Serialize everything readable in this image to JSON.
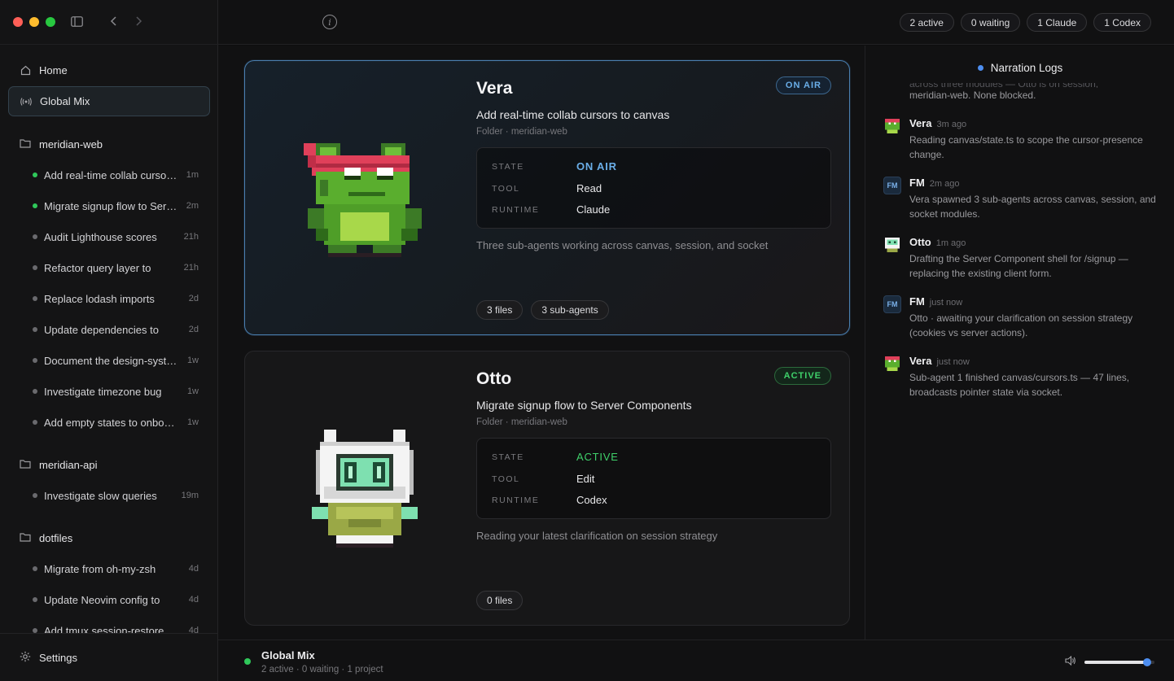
{
  "titlebar": {
    "info_icon": "info-icon"
  },
  "status_pills": [
    "2 active",
    "0 waiting",
    "1 Claude",
    "1 Codex"
  ],
  "nav": {
    "home": "Home",
    "global_mix": "Global Mix"
  },
  "projects": [
    {
      "name": "meridian-web",
      "tasks": [
        {
          "label": "Add real-time collab cursors to canvas",
          "time": "1m",
          "active": true
        },
        {
          "label": "Migrate signup flow to Server Components",
          "time": "2m",
          "active": true
        },
        {
          "label": "Audit Lighthouse scores",
          "time": "21h",
          "active": false
        },
        {
          "label": "Refactor query layer to",
          "time": "21h",
          "active": false
        },
        {
          "label": "Replace lodash imports",
          "time": "2d",
          "active": false
        },
        {
          "label": "Update dependencies to",
          "time": "2d",
          "active": false
        },
        {
          "label": "Document the design-system",
          "time": "1w",
          "active": false
        },
        {
          "label": "Investigate timezone bug",
          "time": "1w",
          "active": false
        },
        {
          "label": "Add empty states to onboarding",
          "time": "1w",
          "active": false
        }
      ]
    },
    {
      "name": "meridian-api",
      "tasks": [
        {
          "label": "Investigate slow queries",
          "time": "19m",
          "active": false
        }
      ]
    },
    {
      "name": "dotfiles",
      "tasks": [
        {
          "label": "Migrate from oh-my-zsh",
          "time": "4d",
          "active": false
        },
        {
          "label": "Update Neovim config to",
          "time": "4d",
          "active": false
        },
        {
          "label": "Add tmux session-restore",
          "time": "4d",
          "active": false
        }
      ]
    }
  ],
  "settings_label": "Settings",
  "cards": {
    "vera": {
      "name": "Vera",
      "badge": "ON AIR",
      "task": "Add real-time collab cursors to canvas",
      "folder": "Folder · meridian-web",
      "state_key": "STATE",
      "state_val": "ON AIR",
      "tool_key": "TOOL",
      "tool_val": "Read",
      "runtime_key": "RUNTIME",
      "runtime_val": "Claude",
      "desc": "Three sub-agents working across canvas, session, and socket",
      "chips": [
        "3 files",
        "3 sub-agents"
      ]
    },
    "otto": {
      "name": "Otto",
      "badge": "ACTIVE",
      "task": "Migrate signup flow to Server Components",
      "folder": "Folder · meridian-web",
      "state_key": "STATE",
      "state_val": "ACTIVE",
      "tool_key": "TOOL",
      "tool_val": "Edit",
      "runtime_key": "RUNTIME",
      "runtime_val": "Codex",
      "desc": "Reading your latest clarification on session strategy",
      "chips": [
        "0 files"
      ]
    }
  },
  "logs": {
    "title": "Narration Logs",
    "fragment_top": "across three modules — Otto is on session,",
    "fragment": "meridian-web. None blocked.",
    "entries": [
      {
        "who": "Vera",
        "when": "3m ago",
        "msg": "Reading canvas/state.ts to scope the cursor-presence change.",
        "avatar": "vera"
      },
      {
        "who": "FM",
        "when": "2m ago",
        "msg": "Vera spawned 3 sub-agents across canvas, session, and socket modules.",
        "avatar": "fm",
        "initials": "FM"
      },
      {
        "who": "Otto",
        "when": "1m ago",
        "msg": "Drafting the Server Component shell for /signup — replacing the existing client form.",
        "avatar": "otto"
      },
      {
        "who": "FM",
        "when": "just now",
        "msg": "Otto · awaiting your clarification on session strategy (cookies vs server actions).",
        "avatar": "fm",
        "initials": "FM"
      },
      {
        "who": "Vera",
        "when": "just now",
        "msg": "Sub-agent 1 finished canvas/cursors.ts — 47 lines, broadcasts pointer state via socket.",
        "avatar": "vera"
      }
    ]
  },
  "bottombar": {
    "title": "Global Mix",
    "subtitle": "2 active · 0 waiting · 1 project",
    "volume": 0.9
  },
  "colors": {
    "accent_blue": "#4d8ef0",
    "active_green": "#2fc85a",
    "onair_blue": "#6aaee8"
  }
}
